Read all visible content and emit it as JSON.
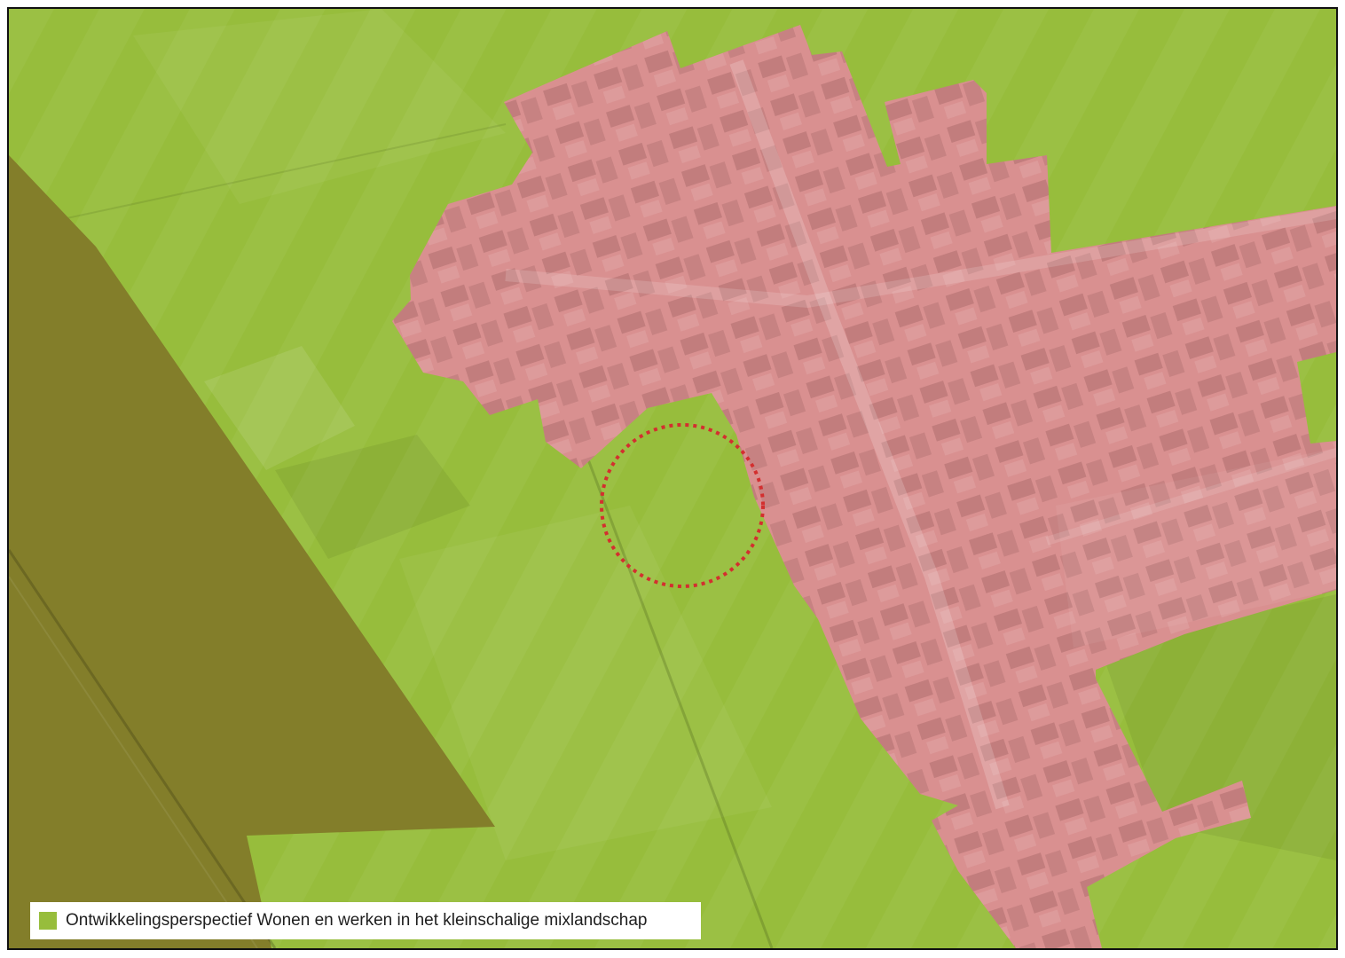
{
  "map": {
    "colors": {
      "mixlandscape": "#97bd3c",
      "mixlandscape_dark": "#8aaf35",
      "village_zone": "#d99090",
      "village_zone_dark": "#c97c7f",
      "elevated_road_zone": "#837e2a",
      "site_marker": "#d32f2f"
    },
    "legend": {
      "items": [
        {
          "label": "Ontwikkelingsperspectief Wonen en werken in het kleinschalige mixlandschap",
          "color": "#97bd3c",
          "icon": "square-swatch"
        }
      ]
    },
    "site_marker": {
      "style": "dotted-circle",
      "icon": "dotted-circle-marker"
    }
  }
}
